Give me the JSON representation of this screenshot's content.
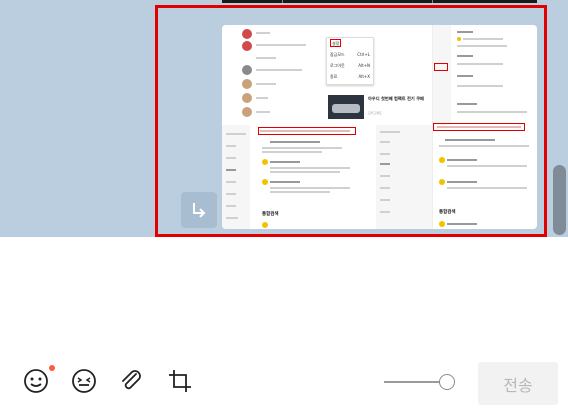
{
  "screenshot": {
    "context_menu": {
      "items": [
        {
          "label": "설정",
          "shortcut": ""
        },
        {
          "label": "잠금모드",
          "shortcut": "Ctrl+L"
        },
        {
          "label": "로그아웃",
          "shortcut": "Alt+N"
        },
        {
          "label": "종료",
          "shortcut": "Alt+X"
        }
      ]
    },
    "news": {
      "title": "아우디 첫번째 컴팩트 전기 쿠페",
      "source": "모터그래프"
    },
    "left_section": {
      "heading": "통합검색"
    },
    "right_section": {
      "heading": "통합검색"
    }
  },
  "toolbar": {
    "emoji_icon": "smile-icon",
    "sticker_icon": "sticker-icon",
    "attach_icon": "paperclip-icon",
    "capture_icon": "crop-icon"
  },
  "send_button": {
    "label": "전송"
  },
  "colors": {
    "chat_background": "#bacee0",
    "selection_border": "#e00000",
    "notification_dot": "#ff5a3c"
  }
}
